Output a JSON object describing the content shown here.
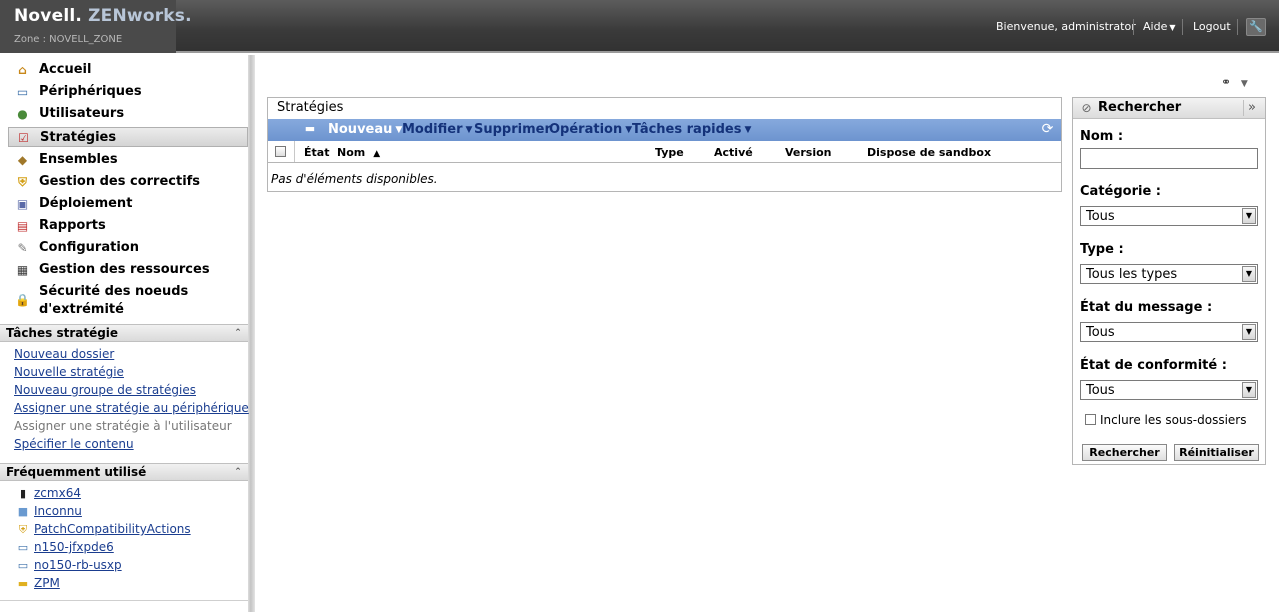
{
  "header": {
    "brand_novell": "Novell.",
    "brand_zenworks": "ZENworks.",
    "zone": "Zone : NOVELL_ZONE",
    "welcome": "Bienvenue, administrator",
    "help": "Aide",
    "logout": "Logout"
  },
  "sidebar": {
    "nav": [
      {
        "label": "Accueil",
        "icon": "home-icon"
      },
      {
        "label": "Périphériques",
        "icon": "monitor-icon"
      },
      {
        "label": "Utilisateurs",
        "icon": "users-icon"
      },
      {
        "label": "Stratégies",
        "icon": "policy-icon"
      },
      {
        "label": "Ensembles",
        "icon": "bundle-icon"
      },
      {
        "label": "Gestion des correctifs",
        "icon": "shield-icon"
      },
      {
        "label": "Déploiement",
        "icon": "deployment-icon"
      },
      {
        "label": "Rapports",
        "icon": "report-icon"
      },
      {
        "label": "Configuration",
        "icon": "wrench-icon"
      },
      {
        "label": "Gestion des ressources",
        "icon": "asset-icon"
      },
      {
        "label": "Sécurité des noeuds d'extrémité",
        "icon": "lock-icon"
      }
    ],
    "tasks_title": "Tâches stratégie",
    "tasks": [
      "Nouveau dossier",
      "Nouvelle stratégie",
      "Nouveau groupe de stratégies",
      "Assigner une stratégie au périphérique",
      "Assigner une stratégie à l'utilisateur",
      "Spécifier le contenu"
    ],
    "freq_title": "Fréquemment utilisé",
    "freq": [
      {
        "label": "zcmx64",
        "icon": "server-icon"
      },
      {
        "label": "Inconnu",
        "icon": "unknown-device-icon"
      },
      {
        "label": "PatchCompatibilityActions",
        "icon": "shield-icon"
      },
      {
        "label": "n150-jfxpde6",
        "icon": "workstation-icon"
      },
      {
        "label": "no150-rb-usxp",
        "icon": "workstation-icon"
      },
      {
        "label": "ZPM",
        "icon": "folder-icon"
      }
    ]
  },
  "main": {
    "panel_title": "Stratégies",
    "toolbar": {
      "nouveau": "Nouveau",
      "modifier": "Modifier",
      "supprimer": "Supprimer",
      "operation": "Opération",
      "taches_rapides": "Tâches rapides"
    },
    "columns": {
      "etat": "État",
      "nom": "Nom",
      "type": "Type",
      "active": "Activé",
      "version": "Version",
      "sandbox": "Dispose de sandbox"
    },
    "empty_message": "Pas d'éléments disponibles."
  },
  "search": {
    "title": "Rechercher",
    "nom_label": "Nom :",
    "nom_value": "",
    "categorie_label": "Catégorie :",
    "categorie_value": "Tous",
    "type_label": "Type :",
    "type_value": "Tous les types",
    "etat_message_label": "État du message :",
    "etat_message_value": "Tous",
    "conformite_label": "État de conformité :",
    "conformite_value": "Tous",
    "include_sub": "Inclure les sous-dossiers",
    "search_btn": "Rechercher",
    "reset_btn": "Réinitialiser"
  },
  "colors": {
    "header_bg": "#3a3a3a",
    "toolbar_bg": "#7a9fd7",
    "link": "#1a3d8f"
  }
}
